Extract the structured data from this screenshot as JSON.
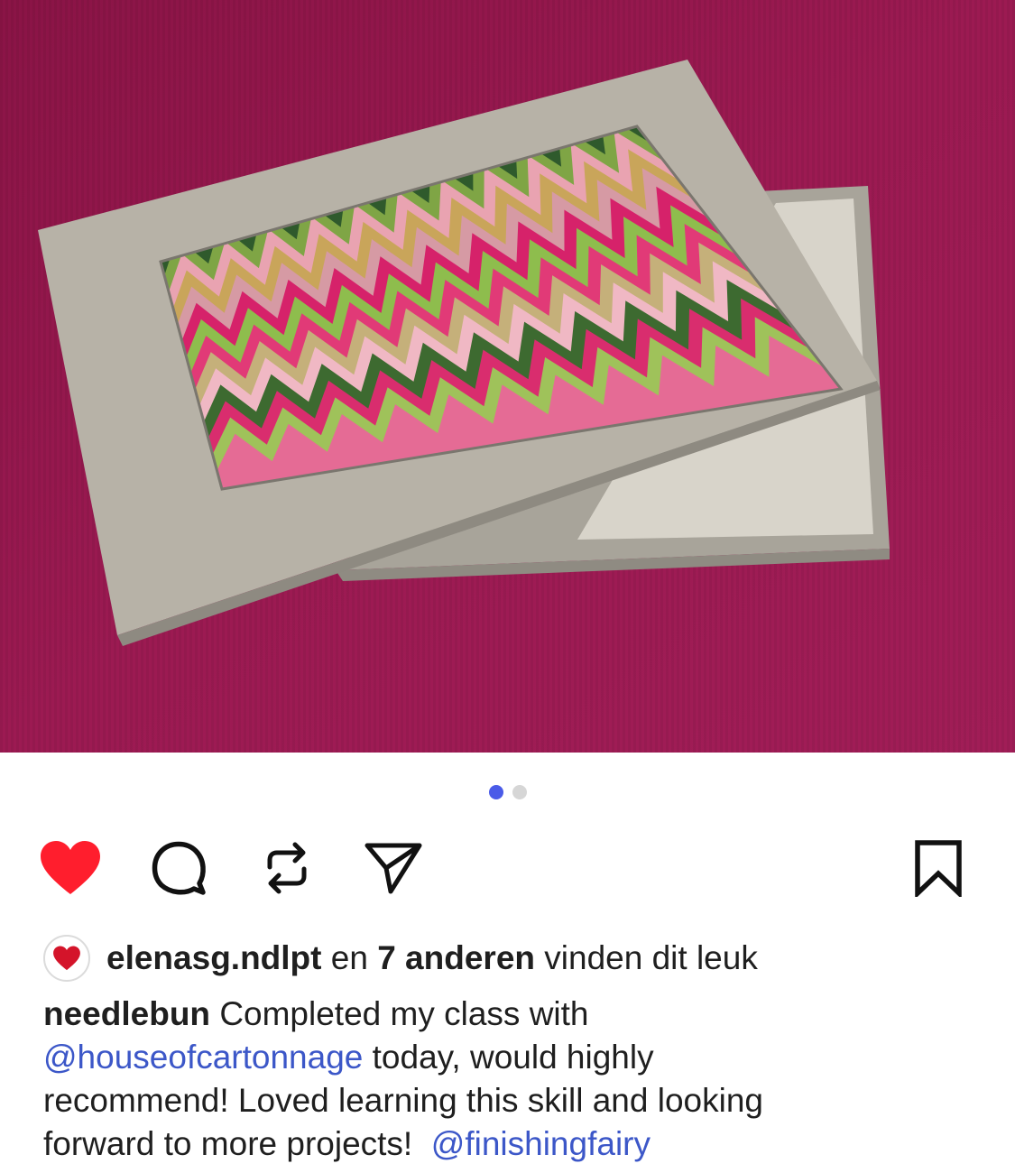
{
  "carousel": {
    "active_dot_color": "#4a5be8",
    "inactive_dot_color": "#d6d6d6",
    "dots": [
      "active",
      "inactive"
    ]
  },
  "actions": {
    "like_icon": "heart-filled-icon",
    "like_color": "#ff1e2d",
    "comment_icon": "comment-icon",
    "repost_icon": "repost-icon",
    "share_icon": "send-icon",
    "save_icon": "bookmark-icon"
  },
  "likes": {
    "first_liker": "elenasg.ndlpt",
    "connector": "en",
    "others": "7 anderen",
    "suffix": "vinden dit leuk"
  },
  "caption": {
    "username": "needlebun",
    "text_1": "Completed my class with",
    "mention_1": "@houseofcartonnage",
    "text_2": "today, would highly",
    "line_3": "recommend!  Loved learning this skill and looking",
    "line_4": "forward to more projects!",
    "mention_2": "@finishingfairy",
    "mention_color": "#3c57c8"
  }
}
